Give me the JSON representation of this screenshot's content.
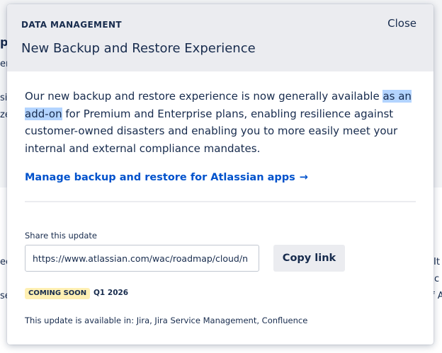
{
  "background": {
    "fragments": [
      "pe",
      "er",
      "si",
      "ze",
      "ec",
      "se",
      "It",
      "c",
      "f A"
    ]
  },
  "modal": {
    "eyebrow": "DATA MANAGEMENT",
    "title": "New Backup and Restore Experience",
    "close_label": "Close",
    "body": {
      "before_highlight": "Our new backup and restore experience is now generally available ",
      "highlight": "as an add-on",
      "after_highlight": " for Premium and Enterprise plans, enabling resilience against customer-owned disasters and enabling you to more easily meet your internal and external compliance mandates."
    },
    "cta_label": "Manage backup and restore for Atlassian apps",
    "cta_arrow": "→",
    "share": {
      "label": "Share this update",
      "url_value": "https://www.atlassian.com/wac/roadmap/cloud/n",
      "copy_label": "Copy link"
    },
    "status": {
      "badge": "COMING SOON",
      "date": "Q1 2026"
    },
    "availability": "This update is available in: Jira, Jira Service Management, Confluence"
  },
  "colors": {
    "accent_link": "#0052cc",
    "header_bg": "#ebecf0",
    "badge_bg": "#fff0b3",
    "highlight": "#b3d4ff"
  }
}
